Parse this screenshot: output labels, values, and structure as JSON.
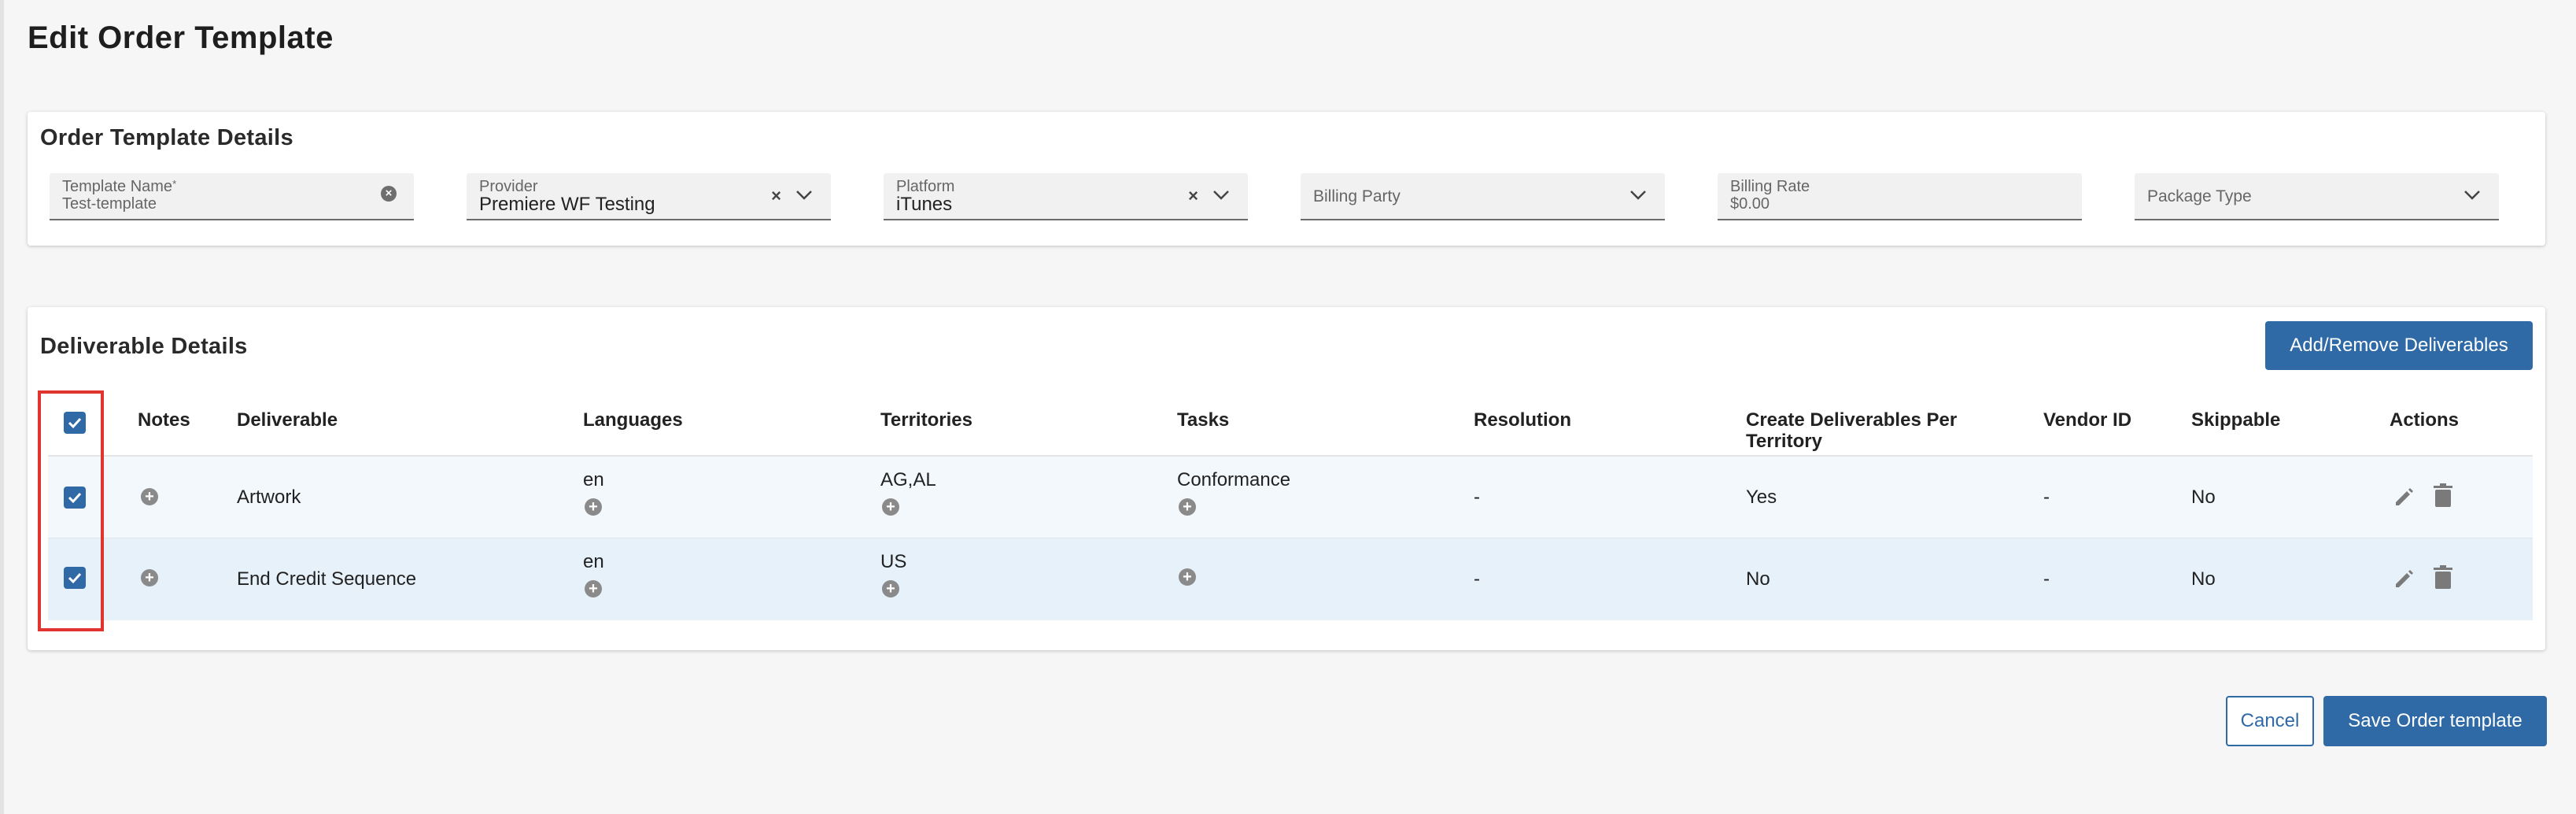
{
  "page": {
    "title": "Edit Order Template"
  },
  "details": {
    "title": "Order Template Details",
    "fields": [
      {
        "label": "Template Name",
        "required_mark": "*",
        "value": "Test-template"
      },
      {
        "label": "Provider",
        "value": "Premiere WF Testing"
      },
      {
        "label": "Platform",
        "value": "iTunes"
      },
      {
        "label": "Billing Party",
        "value": ""
      },
      {
        "label": "Billing Rate",
        "value": "$0.00"
      },
      {
        "label": "Package Type",
        "value": ""
      }
    ]
  },
  "deliverables": {
    "title": "Deliverable Details",
    "add_button": "Add/Remove Deliverables",
    "columns": {
      "notes": "Notes",
      "deliverable": "Deliverable",
      "languages": "Languages",
      "territories": "Territories",
      "tasks": "Tasks",
      "resolution": "Resolution",
      "create_per_territory": "Create Deliverables Per Territory",
      "vendor_id": "Vendor ID",
      "skippable": "Skippable",
      "actions": "Actions"
    },
    "header_checkbox_checked": true,
    "rows": [
      {
        "checked": true,
        "deliverable": "Artwork",
        "languages": "en",
        "territories": "AG,AL",
        "tasks": "Conformance",
        "resolution": "-",
        "create_per_territory": "Yes",
        "vendor_id": "-",
        "skippable": "No"
      },
      {
        "checked": true,
        "deliverable": "End Credit Sequence",
        "languages": "en",
        "territories": "US",
        "tasks": "",
        "resolution": "-",
        "create_per_territory": "No",
        "vendor_id": "-",
        "skippable": "No"
      }
    ]
  },
  "footer": {
    "cancel": "Cancel",
    "save": "Save Order template"
  },
  "icons": {
    "clear": "clear-circle-icon",
    "remove": "close-icon",
    "dropdown": "chevron-down-icon",
    "add": "plus-circle-icon",
    "edit": "pencil-icon",
    "delete": "trash-icon",
    "check": "checkmark-icon"
  },
  "colors": {
    "primary": "#2f6aa7",
    "highlight": "#e0342e",
    "row_alt": "#e6f1fa"
  }
}
